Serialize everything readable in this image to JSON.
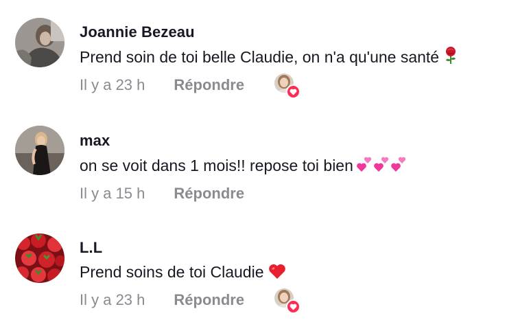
{
  "comments": [
    {
      "username": "Joannie Bezeau",
      "text": "Prend soin de toi belle Claudie, on n'a qu'une santé",
      "emoji": "rose-emoji",
      "time": "Il y a 23 h",
      "reply_label": "Répondre",
      "creator_liked": true
    },
    {
      "username": "max",
      "text": "on se voit dans 1 mois!! repose toi bien",
      "emoji": "two-hearts-emoji",
      "time": "Il y a 15 h",
      "reply_label": "Répondre",
      "creator_liked": false
    },
    {
      "username": "L.L",
      "text": "Prend soins de toi Claudie",
      "emoji": "red-heart-emoji",
      "time": "Il y a 23 h",
      "reply_label": "Répondre",
      "creator_liked": true
    }
  ],
  "colors": {
    "text": "#161823",
    "muted": "#8a8b91",
    "like_badge": "#fe2c55"
  }
}
